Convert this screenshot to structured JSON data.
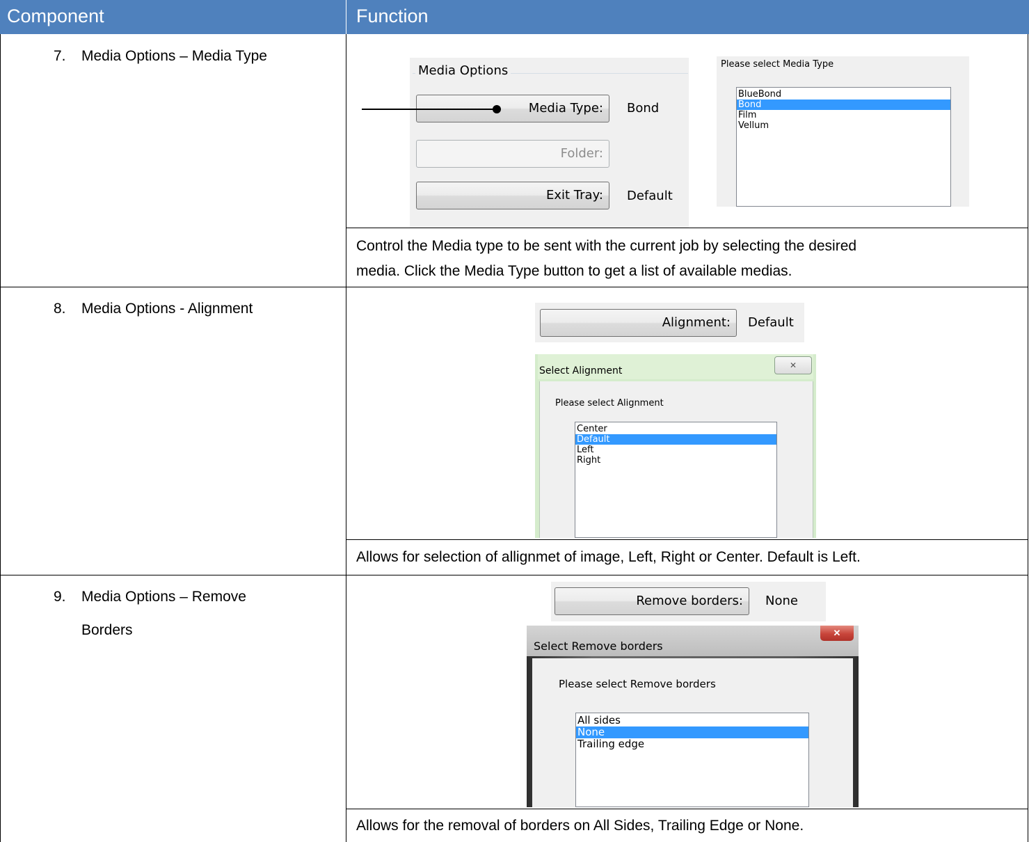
{
  "table": {
    "headers": {
      "component": "Component",
      "function": "Function"
    },
    "rows": [
      {
        "number": "7.",
        "component": "Media Options – Media Type",
        "description_lines": [
          "Control the Media type to be sent with the current job by selecting the desired",
          "media. Click the Media Type button to get a list of available medias."
        ]
      },
      {
        "number": "8.",
        "component": "Media Options - Alignment",
        "description_lines": [
          "Allows for selection of allignmet of image, Left, Right or Center. Default is Left."
        ]
      },
      {
        "number": "9.",
        "component_lines": [
          "Media Options – Remove",
          "Borders"
        ],
        "description_lines": [
          "Allows for the removal of borders on All Sides, Trailing Edge or None."
        ]
      }
    ]
  },
  "media_options": {
    "group_label": "Media Options",
    "media_type_button": "Media Type:",
    "media_type_value": "Bond",
    "folder_button": "Folder:",
    "exit_tray_button": "Exit Tray:",
    "exit_tray_value": "Default"
  },
  "media_type_list": {
    "prompt": "Please select Media Type",
    "items": [
      "BlueBond",
      "Bond",
      "Film",
      "Vellum"
    ],
    "selected": "Bond"
  },
  "alignment": {
    "button": "Alignment:",
    "value": "Default",
    "dialog_title": "Select Alignment",
    "prompt": "Please select Alignment",
    "items": [
      "Center",
      "Default",
      "Left",
      "Right"
    ],
    "selected": "Default",
    "close_glyph": "✕"
  },
  "remove_borders": {
    "button": "Remove borders:",
    "value": "None",
    "dialog_title": "Select Remove borders",
    "prompt": "Please select Remove borders",
    "items": [
      "All sides",
      "None",
      "Trailing edge"
    ],
    "selected": "None",
    "close_glyph": "✕"
  },
  "colors": {
    "header_bg": "#4f81bd",
    "selection": "#3399ff",
    "close_button_red": "#c8453a"
  }
}
